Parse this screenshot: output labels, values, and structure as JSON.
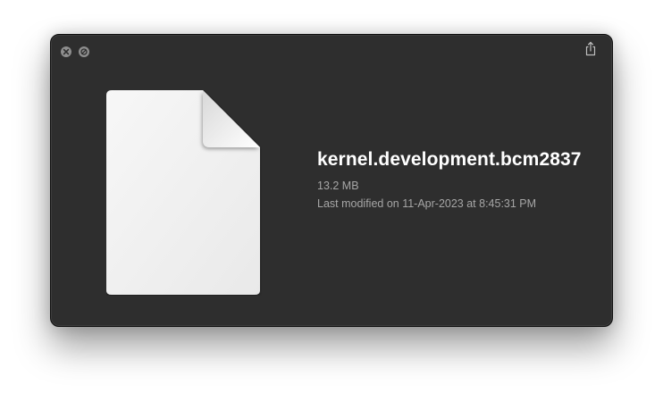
{
  "window": {
    "controls": {
      "close_icon": "close-icon",
      "disable_icon": "prohibit-icon",
      "share_icon": "share-icon"
    }
  },
  "file": {
    "icon": "generic-document-icon",
    "name": "kernel.development.bcm2837",
    "size": "13.2 MB",
    "modified": "Last modified on 11-Apr-2023 at 8:45:31 PM"
  },
  "colors": {
    "window_bg": "#2e2e2e",
    "title_text": "#ffffff",
    "secondary_text": "#a6a6a6",
    "control_button": "#8e8e8e"
  }
}
